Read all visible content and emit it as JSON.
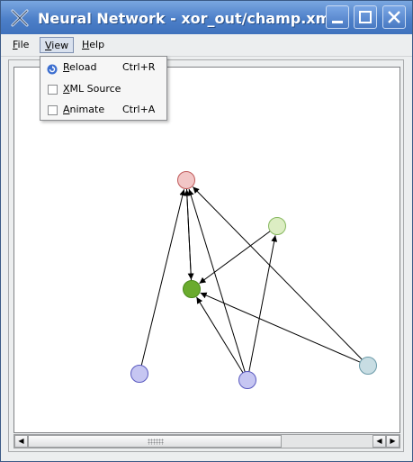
{
  "window": {
    "title": "Neural Network - xor_out/champ.xml",
    "buttons": {
      "minimize": "minimize",
      "maximize": "maximize",
      "close": "close"
    }
  },
  "menubar": {
    "file": {
      "first": "F",
      "rest": "ile"
    },
    "view": {
      "first": "V",
      "rest": "iew"
    },
    "help": {
      "first": "H",
      "rest": "elp"
    }
  },
  "view_menu": {
    "items": [
      {
        "first": "R",
        "rest": "eload",
        "shortcut": "Ctrl+R",
        "icon": "reload-icon"
      },
      {
        "first": "X",
        "rest": "ML Source",
        "shortcut": "",
        "icon": "checkbox",
        "checked": false
      },
      {
        "first": "A",
        "rest": "nimate",
        "shortcut": "Ctrl+A",
        "icon": "checkbox",
        "checked": false
      }
    ]
  },
  "network": {
    "nodes": [
      {
        "id": "output",
        "fill": "#f2c6c6",
        "stroke": "#c05a5a"
      },
      {
        "id": "hidden-1",
        "fill": "#dcedc3",
        "stroke": "#86b85e"
      },
      {
        "id": "hidden-2",
        "fill": "#6aab2e",
        "stroke": "#4a8a1a"
      },
      {
        "id": "input-1",
        "fill": "#c6c6f2",
        "stroke": "#5a5ac0"
      },
      {
        "id": "input-2",
        "fill": "#c6c6f2",
        "stroke": "#5a5ac0"
      },
      {
        "id": "bias",
        "fill": "#c8dde3",
        "stroke": "#6a9aa8"
      }
    ],
    "edges": [
      {
        "from": "input-1",
        "to": "output"
      },
      {
        "from": "input-2",
        "to": "output"
      },
      {
        "from": "bias",
        "to": "output"
      },
      {
        "from": "hidden-2",
        "to": "output"
      },
      {
        "from": "output",
        "to": "hidden-2"
      },
      {
        "from": "hidden-1",
        "to": "hidden-2"
      },
      {
        "from": "input-2",
        "to": "hidden-2"
      },
      {
        "from": "bias",
        "to": "hidden-2"
      },
      {
        "from": "input-2",
        "to": "hidden-1"
      }
    ]
  },
  "colors": {
    "titlebar": "#4c7fc8",
    "accent": "#3f72bd"
  }
}
